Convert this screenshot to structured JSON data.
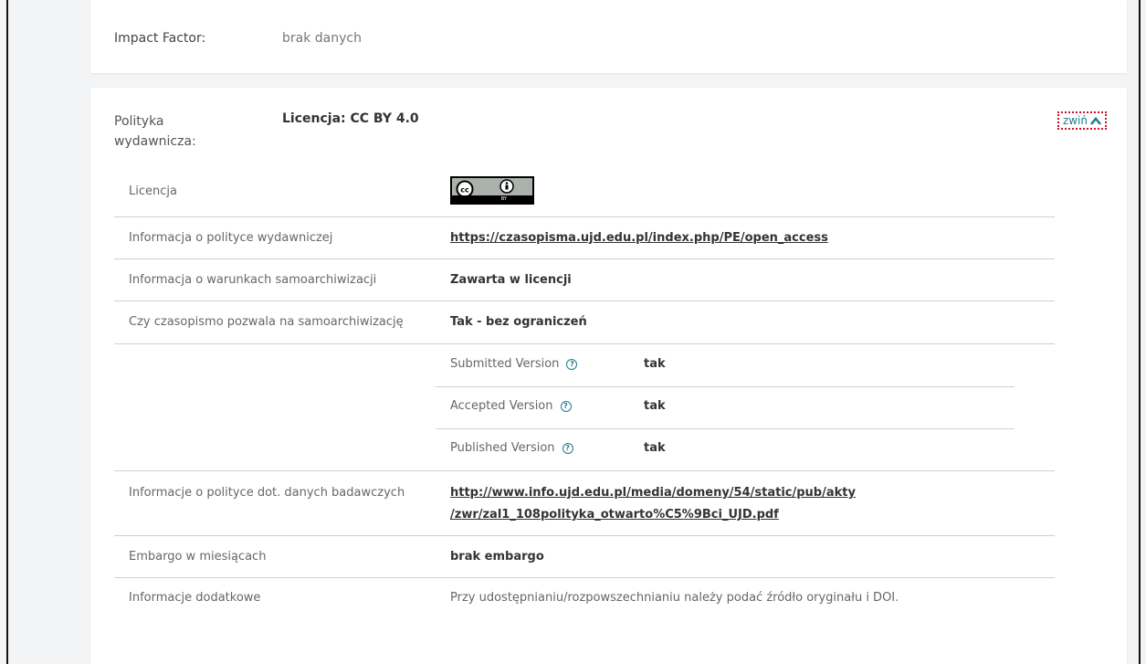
{
  "impact_factor": {
    "label": "Impact Factor:",
    "value": "brak danych"
  },
  "policy": {
    "label": "Polityka wydawnicza:",
    "license_summary": "Licencja: CC BY 4.0",
    "toggle_label": "zwiń"
  },
  "rows": [
    {
      "label": "Licencja",
      "badge_text": "BY"
    },
    {
      "label": "Informacja o polityce wydawniczej",
      "value": "https://czasopisma.ujd.edu.pl/index.php/PE/open_access"
    },
    {
      "label": "Informacja o warunkach samoarchiwizacji",
      "value": "Zawarta w licencji"
    },
    {
      "label": "Czy czasopismo pozwala na samoarchiwizację",
      "value": "Tak - bez ograniczeń"
    },
    {
      "label": "Informacje o polityce dot. danych badawczych",
      "value_line1": "http://www.info.ujd.edu.pl/media/domeny/54/static/pub/akty",
      "value_line2": "/zwr/zal1_108polityka_otwarto%C5%9Bci_UJD.pdf"
    },
    {
      "label": "Embargo w miesiącach",
      "value": "brak embargo"
    },
    {
      "label": "Informacje dodatkowe",
      "value": "Przy udostępnianiu/rozpowszechnianiu należy podać źródło oryginału i DOI."
    }
  ],
  "versions": [
    {
      "label": "Submitted Version",
      "value": "tak"
    },
    {
      "label": "Accepted Version",
      "value": "tak"
    },
    {
      "label": "Published Version",
      "value": "tak"
    }
  ],
  "colors": {
    "accent": "#1c7c8c",
    "focus_outline": "#c8102e"
  }
}
